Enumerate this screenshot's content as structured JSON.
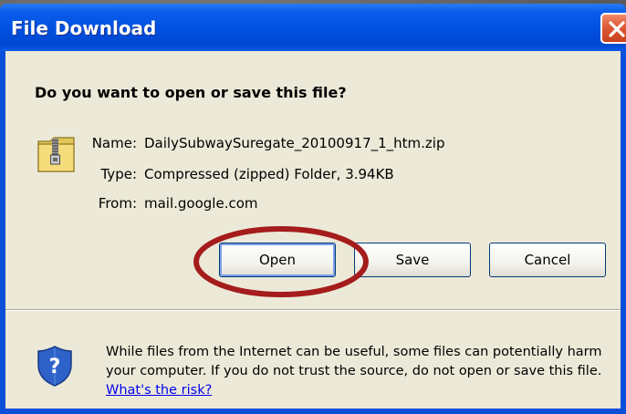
{
  "window": {
    "title": "File Download"
  },
  "dialog": {
    "question": "Do you want to open or save this file?",
    "file": {
      "name_label": "Name:",
      "name_value": "DailySubwaySuregate_20100917_1_htm.zip",
      "type_label": "Type:",
      "type_value": "Compressed (zipped) Folder, 3.94KB",
      "from_label": "From:",
      "from_value": "mail.google.com"
    },
    "buttons": {
      "open": "Open",
      "save": "Save",
      "cancel": "Cancel"
    },
    "warning": {
      "text": "While files from the Internet can be useful, some files can potentially harm your computer. If you do not trust the source, do not open or save this file.",
      "link": "What's the risk?"
    }
  },
  "icons": {
    "file": "zip-folder-icon",
    "warning": "shield-question-icon",
    "close": "close-icon"
  },
  "colors": {
    "titlebar": "#0050e0",
    "client": "#ece9d8",
    "close": "#dd5a36",
    "highlight": "#a51c1c",
    "link": "#0000ee"
  }
}
